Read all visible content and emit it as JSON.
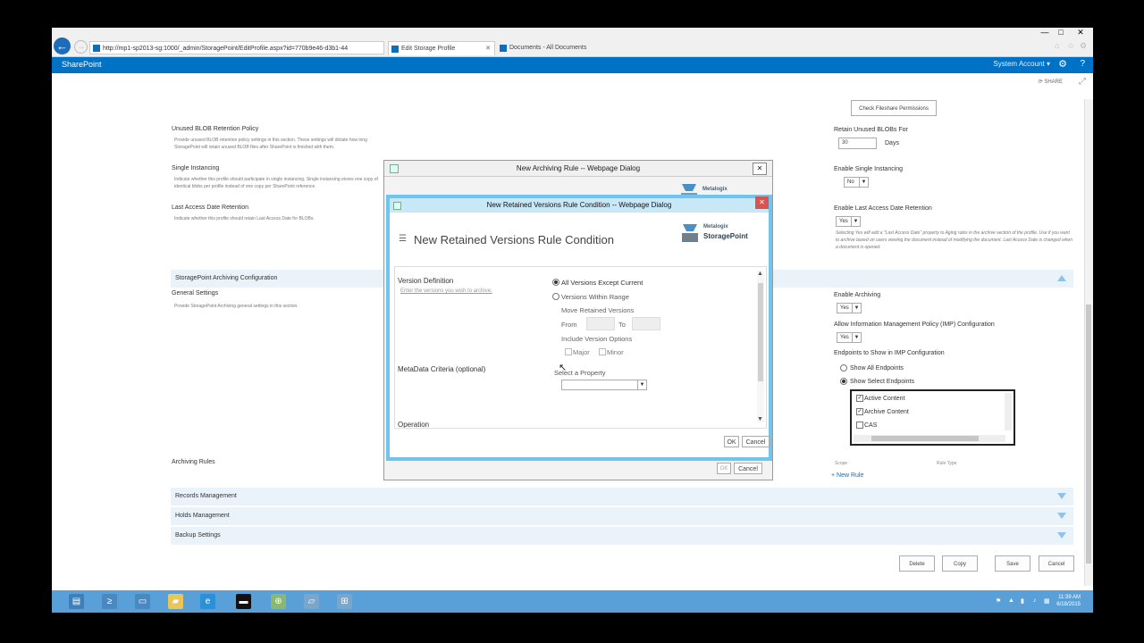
{
  "browser": {
    "address_url": "http://mp1-sp2013-sg:1000/_admin/StoragePoint/EditProfile.aspx?id=770b9e46-d3b1-44",
    "tabs": [
      {
        "label": "Edit Storage Profile",
        "active": true
      },
      {
        "label": "Documents - All Documents",
        "active": false
      }
    ],
    "window_controls": [
      "—",
      "□",
      "✕"
    ]
  },
  "suite_bar": {
    "brand": "SharePoint",
    "account": "System Account ▾",
    "share": "SHARE"
  },
  "page": {
    "check_fileshare_button": "Check Fileshare Permissions",
    "unused_blob": {
      "title": "Unused BLOB Retention Policy",
      "desc": "Provide unused BLOB retention policy settings in this section. These settings will dictate how long StoragePoint will retain unused BLOB files after SharePoint is finished with them.",
      "right_label": "Retain Unused BLOBs For",
      "value": "30",
      "unit": "Days"
    },
    "single_instancing": {
      "title": "Single Instancing",
      "desc": "Indicate whether this profile should participate in single instancing. Single instancing stores one copy of identical blobs per profile instead of one copy per SharePoint reference.",
      "right_label": "Enable Single Instancing",
      "value": "No"
    },
    "last_access": {
      "title": "Last Access Date Retention",
      "desc": "Indicate whether this profile should retain Last Access Date for BLOBs.",
      "right_label": "Enable Last Access Date Retention",
      "value": "Yes",
      "note": "Selecting Yes will add a \"Last Access Date\" property to Aging rules in the archive section of the profile. Use if you want to archive based on users viewing the document instead of modifying the document. Last Access Date is changed when a document is opened."
    },
    "archiving_section": "StoragePoint Archiving Configuration",
    "general_settings": {
      "title": "General Settings",
      "desc": "Provide StoragePoint Archiving general settings in this section."
    },
    "enable_archiving": {
      "label": "Enable Archiving",
      "value": "Yes"
    },
    "allow_imp": {
      "label": "Allow Information Management Policy (IMP) Configuration",
      "value": "Yes"
    },
    "endpoints": {
      "label": "Endpoints to Show in IMP Configuration",
      "radio_all": "Show All Endpoints",
      "radio_select": "Show Select Endpoints",
      "items": [
        {
          "label": "Active Content",
          "checked": true
        },
        {
          "label": "Archive Content",
          "checked": true
        },
        {
          "label": "CAS",
          "checked": false
        }
      ]
    },
    "archiving_rules": "Archiving Rules",
    "scope_col": "Scope",
    "rule_type_col": "Rule Type",
    "new_rule": "+ New Rule",
    "sections": [
      "Records Management",
      "Holds Management",
      "Backup Settings"
    ],
    "footer_buttons": [
      "Delete",
      "Copy",
      "Save",
      "Cancel"
    ]
  },
  "dialog_outer": {
    "title": "New Archiving Rule -- Webpage Dialog",
    "logo_top": "Metalogix",
    "logo_bottom": "StoragePoint",
    "ok": "OK",
    "cancel": "Cancel"
  },
  "dialog_inner": {
    "title": "New Retained Versions Rule Condition -- Webpage Dialog",
    "heading": "New Retained Versions Rule Condition",
    "logo_top": "Metalogix",
    "logo_bottom": "StoragePoint",
    "version_definition": "Version Definition",
    "version_hint": "Enter the versions you wish to archive.",
    "radio_all_except": "All Versions Except Current",
    "radio_within_range": "Versions Within Range",
    "move_retained": "Move Retained Versions",
    "from": "From",
    "to": "To",
    "include_options": "Include Version Options",
    "major": "Major",
    "minor": "Minor",
    "metadata_criteria": "MetaData Criteria (optional)",
    "select_property": "Select a Property",
    "operation": "Operation",
    "ok": "OK",
    "cancel": "Cancel"
  },
  "taskbar": {
    "time": "11:39 AM",
    "date": "6/18/2015"
  },
  "colors": {
    "suite_bar": "#0072c6",
    "dialog_border": "#6ec6ef",
    "section_bar": "#eaf2fa",
    "taskbar": "#5aa0d8"
  }
}
